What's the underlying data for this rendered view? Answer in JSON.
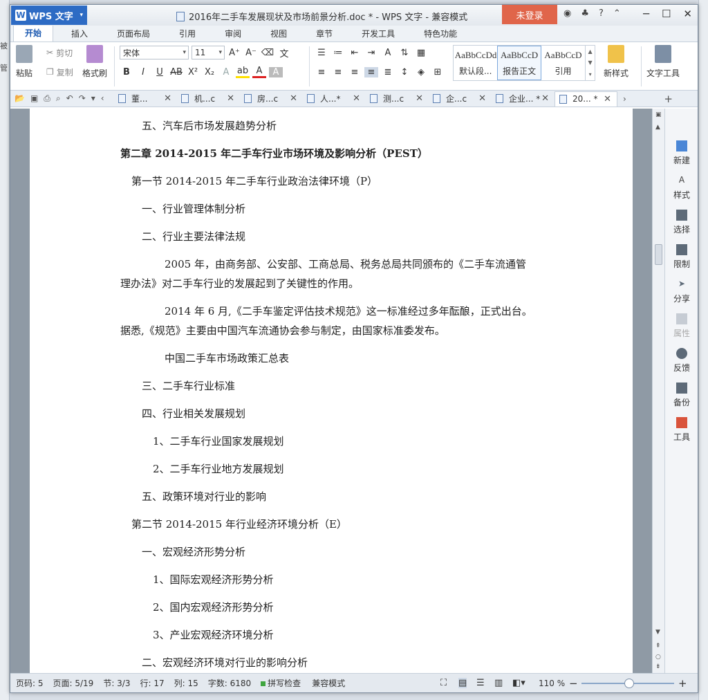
{
  "desktop": {
    "left_labels": [
      "被",
      "管"
    ]
  },
  "titlebar": {
    "app_name": "WPS 文字",
    "document_title": "2016年二手车发展现状及市场前景分析.doc * - WPS 文字 - 兼容模式",
    "login_label": "未登录",
    "help_label": "?"
  },
  "ribbon_tabs": [
    "开始",
    "插入",
    "页面布局",
    "引用",
    "审阅",
    "视图",
    "章节",
    "开发工具",
    "特色功能"
  ],
  "ribbon": {
    "paste": "粘贴",
    "cut": "剪切",
    "copy": "复制",
    "format_painter": "格式刷",
    "font_name": "宋体",
    "font_size": "11",
    "styles": [
      {
        "sample": "AaBbCcDd",
        "label": "默认段..."
      },
      {
        "sample": "AaBbCcD",
        "label": "报告正文"
      },
      {
        "sample": "AaBbCcD",
        "label": "引用"
      }
    ],
    "new_style": "新样式",
    "text_tools": "文字工具"
  },
  "doc_tabs": [
    {
      "label": "董...",
      "active": false
    },
    {
      "label": "机...c",
      "active": false
    },
    {
      "label": "房...c",
      "active": false
    },
    {
      "label": "人...*",
      "active": false
    },
    {
      "label": "测...c",
      "active": false
    },
    {
      "label": "企...c",
      "active": false
    },
    {
      "label": "企业... *",
      "active": false
    },
    {
      "label": "20... *",
      "active": true
    }
  ],
  "document": {
    "lines": [
      {
        "text": "五、汽车后市场发展趋势分析",
        "bold": false
      },
      {
        "text": "第二章  2014-2015 年二手车行业市场环境及影响分析（PEST）",
        "bold": true
      },
      {
        "text": "第一节  2014-2015 年二手车行业政治法律环境（P）",
        "bold": false
      },
      {
        "text": "一、行业管理体制分析",
        "bold": false
      },
      {
        "text": "二、行业主要法律法规",
        "bold": false
      },
      {
        "text": "2005 年，由商务部、公安部、工商总局、税务总局共同颁布的《二手车流通管",
        "bold": false
      },
      {
        "text": "理办法》对二手车行业的发展起到了关键性的作用。",
        "bold": false
      },
      {
        "text": "2014 年 6 月,《二手车鉴定评估技术规范》这一标准经过多年酝酿，正式出台。",
        "bold": false
      },
      {
        "text": "据悉,《规范》主要由中国汽车流通协会参与制定，由国家标准委发布。",
        "bold": false
      },
      {
        "text": "中国二手车市场政策汇总表",
        "bold": false
      },
      {
        "text": "三、二手车行业标准",
        "bold": false
      },
      {
        "text": "四、行业相关发展规划",
        "bold": false
      },
      {
        "text": "1、二手车行业国家发展规划",
        "bold": false
      },
      {
        "text": "2、二手车行业地方发展规划",
        "bold": false
      },
      {
        "text": "五、政策环境对行业的影响",
        "bold": false
      },
      {
        "text": "第二节  2014-2015 年行业经济环境分析（E）",
        "bold": false
      },
      {
        "text": "一、宏观经济形势分析",
        "bold": false
      },
      {
        "text": "1、国际宏观经济形势分析",
        "bold": false
      },
      {
        "text": "2、国内宏观经济形势分析",
        "bold": false
      },
      {
        "text": "3、产业宏观经济环境分析",
        "bold": false
      },
      {
        "text": "二、宏观经济环境对行业的影响分析",
        "bold": false
      }
    ]
  },
  "side_panel": [
    "新建",
    "样式",
    "选择",
    "限制",
    "分享",
    "属性",
    "反馈",
    "备份",
    "工具"
  ],
  "status": {
    "page_num": "页码: 5",
    "pages": "页面: 5/19",
    "section": "节: 3/3",
    "row": "行: 17",
    "col": "列: 15",
    "words": "字数: 6180",
    "spell": "拼写检查",
    "compat": "兼容模式",
    "zoom": "110 %"
  },
  "colors": {
    "accent": "#2d6bc4",
    "login": "#e0654a",
    "active_tab": "#1a58b0"
  }
}
